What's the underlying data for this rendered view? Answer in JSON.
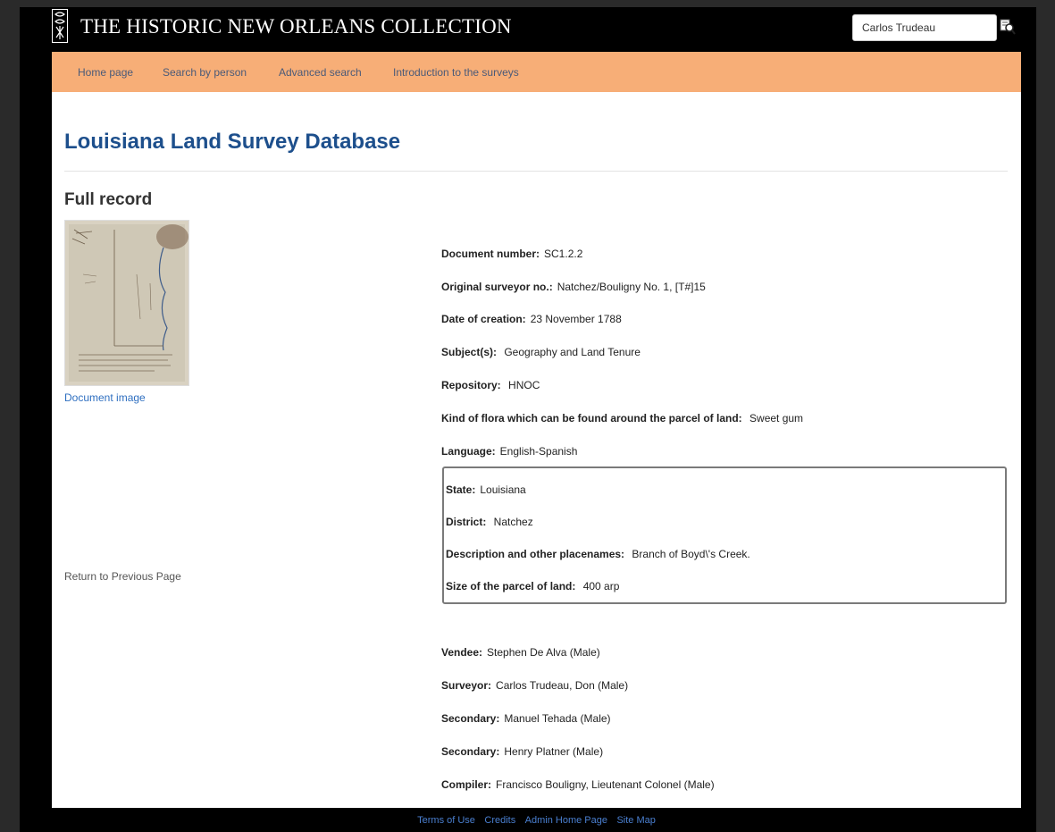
{
  "header": {
    "site_title": "THE HISTORIC NEW ORLEANS COLLECTION",
    "search_value": "Carlos Trudeau",
    "search_icon": "search-icon"
  },
  "nav": {
    "items": [
      {
        "label": "Home page"
      },
      {
        "label": "Search by person"
      },
      {
        "label": "Advanced search"
      },
      {
        "label": "Introduction to the surveys"
      }
    ]
  },
  "main": {
    "title": "Louisiana Land Survey Database",
    "subtitle": "Full record",
    "document_image_link": "Document image",
    "return_link": "Return to Previous Page",
    "record": [
      {
        "label": "Document number:",
        "value": "SC1.2.2"
      },
      {
        "label": "Original surveyor no.:",
        "value": "Natchez/Bouligny No. 1, [T#]15"
      },
      {
        "label": "Date of creation:",
        "value": "23 November 1788"
      },
      {
        "label": "Subject(s):",
        "value": " Geography and Land Tenure"
      },
      {
        "label": "Repository:",
        "value": " HNOC"
      },
      {
        "label": "Kind of flora which can be found around the parcel of land:",
        "value": " Sweet gum"
      },
      {
        "label": "Language:",
        "value": "English-Spanish"
      }
    ],
    "location": [
      {
        "label": "State:",
        "value": "Louisiana"
      },
      {
        "label": "District:",
        "value": " Natchez"
      },
      {
        "label": "Description and other placenames:",
        "value": " Branch of Boyd\\'s Creek."
      },
      {
        "label": "Size of the parcel of land:",
        "value": " 400 arp"
      }
    ],
    "people": [
      {
        "label": "Vendee:",
        "value": "Stephen De Alva   (Male)"
      },
      {
        "label": "Surveyor:",
        "value": "Carlos Trudeau, Don   (Male)"
      },
      {
        "label": "Secondary:",
        "value": "Manuel Tehada   (Male)"
      },
      {
        "label": "Secondary:",
        "value": "Henry Platner   (Male)"
      },
      {
        "label": "Compiler:",
        "value": "Francisco Bouligny, Lieutenant Colonel   (Male)"
      }
    ]
  },
  "footer": {
    "links": [
      {
        "label": "Terms of Use"
      },
      {
        "label": "Credits"
      },
      {
        "label": "Admin Home Page"
      },
      {
        "label": "Site Map"
      }
    ]
  },
  "colors": {
    "nav_background": "#f7ae77",
    "title": "#1d4f8c",
    "link": "#2f6fc0"
  }
}
